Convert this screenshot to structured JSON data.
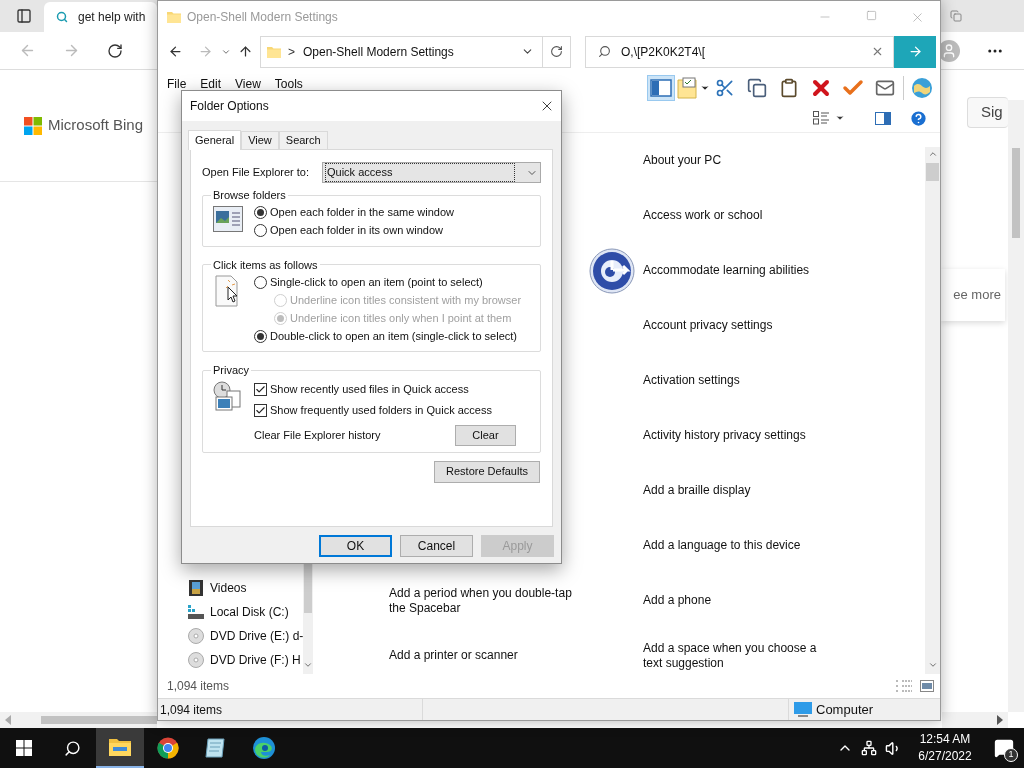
{
  "browser": {
    "tab_title": "get help with",
    "logo": "Microsoft Bing",
    "sign_in": "Sig",
    "card_link": "ee more"
  },
  "explorer": {
    "title": "Open-Shell Modern Settings",
    "breadcrumb_separator": ">",
    "address": "Open-Shell Modern Settings",
    "search_value": "O,\\[P2K0K2T4\\[",
    "menu": [
      "File",
      "Edit",
      "View",
      "Tools"
    ],
    "toolbar": [
      {
        "kind": "preview-pane",
        "selected": true
      },
      {
        "kind": "properties",
        "selected": false
      },
      {
        "kind": "cut",
        "selected": false
      },
      {
        "kind": "copy",
        "selected": false
      },
      {
        "kind": "paste",
        "selected": false
      },
      {
        "kind": "delete",
        "selected": false
      },
      {
        "kind": "check",
        "selected": false
      },
      {
        "kind": "mail",
        "selected": false
      },
      {
        "kind": "globe",
        "selected": false
      }
    ],
    "nav_items": [
      {
        "label": "Videos",
        "kind": "videos"
      },
      {
        "label": "Local Disk (C:)",
        "kind": "disk"
      },
      {
        "label": "DVD Drive (E:) d-",
        "kind": "dvd"
      },
      {
        "label": "DVD Drive (F:) H",
        "kind": "dvd"
      }
    ],
    "items_left": [
      {
        "label": "Add a period when you double-tap the Spacebar"
      },
      {
        "label": "Add a printer or scanner"
      }
    ],
    "items_right": [
      {
        "label": "About your PC",
        "has_icon": false
      },
      {
        "label": "Access work or school",
        "has_icon": false
      },
      {
        "label": "Accommodate learning abilities",
        "has_icon": true
      },
      {
        "label": "Account privacy settings",
        "has_icon": false
      },
      {
        "label": "Activation settings",
        "has_icon": false
      },
      {
        "label": "Activity history privacy settings",
        "has_icon": false
      },
      {
        "label": "Add a braille display",
        "has_icon": false
      },
      {
        "label": "Add a language to this device",
        "has_icon": false
      },
      {
        "label": "Add a phone",
        "has_icon": false
      },
      {
        "label": "Add a space when you choose a text suggestion",
        "has_icon": false
      }
    ],
    "item_count": "1,094 items",
    "status_count": "1,094 items",
    "status_location": "Computer"
  },
  "dialog": {
    "title": "Folder Options",
    "tabs": [
      {
        "label": "General",
        "selected": true
      },
      {
        "label": "View",
        "selected": false
      },
      {
        "label": "Search",
        "selected": false
      }
    ],
    "open_to_label": "Open File Explorer to:",
    "open_to_value": "Quick access",
    "browse_group": {
      "title": "Browse folders",
      "options": [
        {
          "label": "Open each folder in the same window",
          "selected": true,
          "disabled": false
        },
        {
          "label": "Open each folder in its own window",
          "selected": false,
          "disabled": false
        }
      ]
    },
    "click_group": {
      "title": "Click items as follows",
      "options": [
        {
          "label": "Single-click to open an item (point to select)",
          "selected": false,
          "disabled": false,
          "children": [
            {
              "label": "Underline icon titles consistent with my browser",
              "selected": false,
              "disabled": true
            },
            {
              "label": "Underline icon titles only when I point at them",
              "selected": true,
              "disabled": true
            }
          ]
        },
        {
          "label": "Double-click to open an item (single-click to select)",
          "selected": true,
          "disabled": false
        }
      ]
    },
    "privacy_group": {
      "title": "Privacy",
      "checkboxes": [
        {
          "label": "Show recently used files in Quick access",
          "checked": true
        },
        {
          "label": "Show frequently used folders in Quick access",
          "checked": true
        }
      ],
      "clear_label": "Clear File Explorer history",
      "clear_button": "Clear"
    },
    "restore_button": "Restore Defaults",
    "buttons": [
      {
        "label": "OK",
        "focused": true,
        "disabled": false
      },
      {
        "label": "Cancel",
        "focused": false,
        "disabled": false
      },
      {
        "label": "Apply",
        "focused": false,
        "disabled": true
      }
    ]
  },
  "taskbar": {
    "apps": [
      {
        "kind": "start",
        "selected": false
      },
      {
        "kind": "search",
        "selected": false
      },
      {
        "kind": "explorer",
        "selected": true
      },
      {
        "kind": "chrome",
        "selected": false
      },
      {
        "kind": "notes",
        "selected": false
      },
      {
        "kind": "edge",
        "selected": false
      }
    ],
    "time": "12:54 AM",
    "date": "6/27/2022",
    "notifications": "1"
  }
}
